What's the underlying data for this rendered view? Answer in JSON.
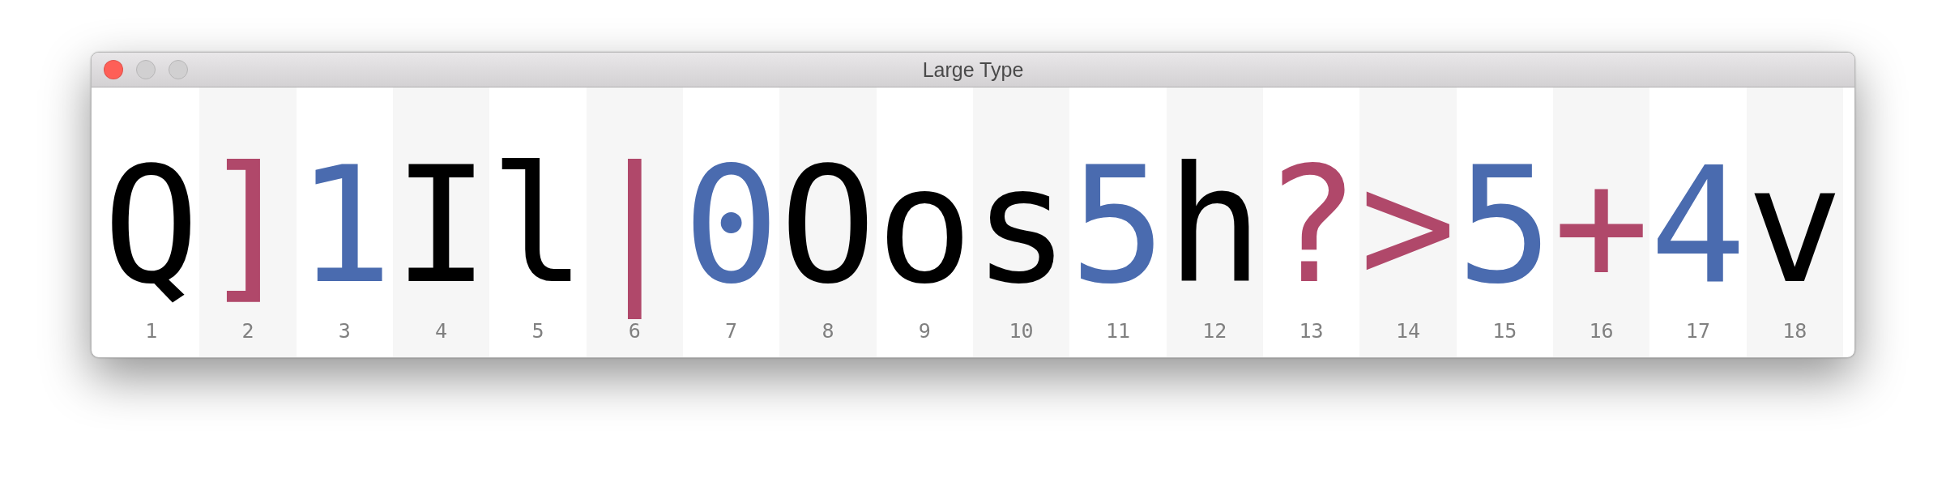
{
  "window": {
    "title": "Large Type",
    "controls": [
      {
        "kind": "close",
        "disabled": false
      },
      {
        "kind": "minimize",
        "disabled": true
      },
      {
        "kind": "zoom",
        "disabled": true
      }
    ]
  },
  "characters": [
    {
      "char": "Q",
      "index": "1",
      "color": "#000000"
    },
    {
      "char": "]",
      "index": "2",
      "color": "#b0486a"
    },
    {
      "char": "1",
      "index": "3",
      "color": "#4a6baf"
    },
    {
      "char": "I",
      "index": "4",
      "color": "#000000"
    },
    {
      "char": "l",
      "index": "5",
      "color": "#000000"
    },
    {
      "char": "|",
      "index": "6",
      "color": "#b0486a"
    },
    {
      "char": "0",
      "index": "7",
      "color": "#4a6baf"
    },
    {
      "char": "O",
      "index": "8",
      "color": "#000000"
    },
    {
      "char": "o",
      "index": "9",
      "color": "#000000"
    },
    {
      "char": "s",
      "index": "10",
      "color": "#000000"
    },
    {
      "char": "5",
      "index": "11",
      "color": "#4a6baf"
    },
    {
      "char": "h",
      "index": "12",
      "color": "#000000"
    },
    {
      "char": "?",
      "index": "13",
      "color": "#b0486a"
    },
    {
      "char": ">",
      "index": "14",
      "color": "#b0486a"
    },
    {
      "char": "5",
      "index": "15",
      "color": "#4a6baf"
    },
    {
      "char": "+",
      "index": "16",
      "color": "#b0486a"
    },
    {
      "char": "4",
      "index": "17",
      "color": "#4a6baf"
    },
    {
      "char": "v",
      "index": "18",
      "color": "#000000"
    }
  ]
}
